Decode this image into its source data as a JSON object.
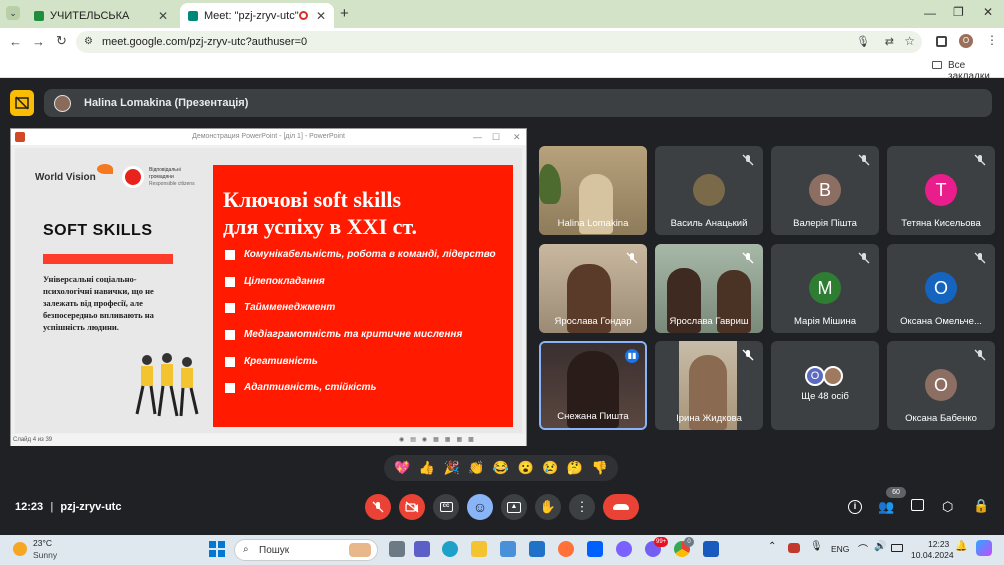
{
  "browser": {
    "tabs": [
      {
        "label": "УЧИТЕЛЬСЬКА"
      },
      {
        "label": "Meet: \"pzj-zryv-utc\""
      }
    ],
    "url": "meet.google.com/pzj-zryv-utc?authuser=0",
    "profile_initial": "O",
    "bookmarks_label": "Все закладки"
  },
  "meet": {
    "presenter_bar": "Halina Lomakina (Презентація)",
    "ppt_window_title": "Демонстрация PowerPoint - [діл 1] - PowerPoint",
    "slide": {
      "logo1": "World Vision",
      "logo2_line1": "Відповідальні",
      "logo2_line2": "громадяни",
      "logo2_line3": "Responsible citizens",
      "left_title": "SOFT SKILLS",
      "left_body": "Універсальні соціально-психологічні навички, що не залежать від професії, але безпосередньо впливають на успішність людини.",
      "heading_line1": "Ключові soft skills",
      "heading_line2": "для успіху в ХХІ ст.",
      "items": [
        "Комунікабельність, робота в команді, лідерство",
        "Цілепокладання",
        "Таймменеджмент",
        "Медіаграмотність та критичне  мислення",
        "Креативність",
        "Адаптивність, стійкість"
      ]
    },
    "ppt_status": "Слайд 4 из 39",
    "participants": [
      {
        "name": "Halina Lomakina",
        "type": "video"
      },
      {
        "name": "Василь Анацький",
        "type": "photo"
      },
      {
        "name": "Валерія Пішта",
        "type": "letter",
        "letter": "B",
        "color": "#8d6e63"
      },
      {
        "name": "Тетяна Кисельова",
        "type": "letter",
        "letter": "T",
        "color": "#e91e8c"
      },
      {
        "name": "Ярослава Гондар",
        "type": "video"
      },
      {
        "name": "Ярослава Гавриш",
        "type": "video"
      },
      {
        "name": "Марія Мішина",
        "type": "letter",
        "letter": "M",
        "color": "#2e7d32"
      },
      {
        "name": "Оксана Омельче...",
        "type": "letter",
        "letter": "O",
        "color": "#1565c0"
      },
      {
        "name": "Снежана Пишта",
        "type": "video"
      },
      {
        "name": "Ірина Жидкова",
        "type": "video"
      },
      {
        "name": "Ще 48 осіб",
        "type": "more",
        "letter": "O"
      },
      {
        "name": "Оксана Бабенко",
        "type": "letter",
        "letter": "O",
        "color": "#8d6e63"
      }
    ],
    "reactions": [
      "💖",
      "👍",
      "🎉",
      "👏",
      "😂",
      "😮",
      "😢",
      "🤔",
      "👎"
    ],
    "time": "12:23",
    "meeting_code": "pzj-zryv-utc",
    "participant_count": "60"
  },
  "taskbar": {
    "weather_temp": "23°C",
    "weather_text": "Sunny",
    "search_placeholder": "Пошук",
    "lang": "ENG",
    "clock_time": "12:23",
    "clock_date": "10.04.2024",
    "viber_badge": "99+",
    "chrome_badge": "0"
  }
}
